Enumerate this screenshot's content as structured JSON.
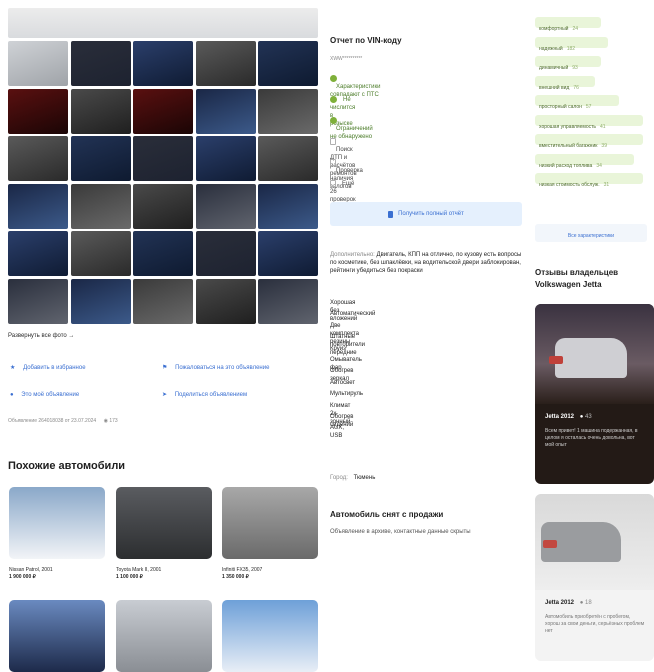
{
  "gallery": {
    "show_all_label": "Развернуть все фото →"
  },
  "actions": {
    "favorite": "Добавить в избранное",
    "complain": "Пожаловаться на это объявление",
    "my_ad": "Это моё объявление",
    "share": "Поделиться объявлением",
    "meta": "Объявление 264018038 от 23.07.2024",
    "views": "173"
  },
  "vin_report": {
    "title": "Отчет по VIN-коду",
    "vin": "XWW**********",
    "checks": [
      {
        "text": "Характеристики совпадают с ПТС",
        "ok": true
      },
      {
        "text": "Не числится в розыске",
        "ok": true
      },
      {
        "text": "Ограничений не обнаружено",
        "ok": true
      },
      {
        "text": "Поиск ДТП и расчётов ремонтов",
        "ok": false
      },
      {
        "text": "Проверка наличия залогов",
        "ok": false
      },
      {
        "text": "Ещё 26 проверок в полном отчёте",
        "ok": false
      }
    ],
    "button": "Получить полный отчёт"
  },
  "description": {
    "label": "Дополнительно:",
    "lead": "Двигатель, КПП на отлично, по кузову есть вопросы по косметике, без шпаклёвки, на водительской двери заблокирован, рейтинги убедиться без покраски",
    "items": [
      "Хорошая без вложений",
      "Автоматический",
      "Две комплекта резины",
      "Штатные повторители передние",
      "Круиз",
      "Омыватель фар",
      "Обогрев зеркал",
      "Автосвет",
      "Мультируль",
      "Климат 2х зонный",
      "Обогрев сидений",
      "AUX, USB"
    ],
    "city_label": "Город:",
    "city": "Тюмень"
  },
  "removed": {
    "title": "Автомобиль снят с продажи",
    "text": "Объявление в архиве, контактные данные скрыты"
  },
  "similar": {
    "title": "Похожие автомобили",
    "cars": [
      {
        "name": "Nissan Patrol, 2001",
        "price": "1 900 000 ₽"
      },
      {
        "name": "Toyota Mark II, 2001",
        "price": "1 100 000 ₽"
      },
      {
        "name": "Infiniti FX35, 2007",
        "price": "1 350 000 ₽"
      },
      {
        "name": "",
        "price": ""
      },
      {
        "name": "",
        "price": ""
      },
      {
        "name": "",
        "price": ""
      }
    ]
  },
  "tags": {
    "items": [
      {
        "label": "комфортный",
        "count": "24"
      },
      {
        "label": "надежный",
        "count": "182"
      },
      {
        "label": "динамичный",
        "count": "93"
      },
      {
        "label": "внешний вид",
        "count": "76"
      },
      {
        "label": "просторный салон",
        "count": "57"
      },
      {
        "label": "хорошая управляемость",
        "count": "41"
      },
      {
        "label": "вместительный багажник",
        "count": "39"
      },
      {
        "label": "низкий расход топлива",
        "count": "34"
      },
      {
        "label": "низкая стоимость обслуж.",
        "count": "31"
      }
    ],
    "more_button": "Все характеристики"
  },
  "reviews": {
    "title": "Отзывы владельцев Volkswagen Jetta",
    "cards": [
      {
        "title": "Jetta 2012",
        "count": "43",
        "text": "Всем привет! 1 машина подержанная, в целом я осталась очень довольна, вот мой опыт"
      },
      {
        "title": "Jetta 2012",
        "count": "18",
        "text": "Автомобиль приобретён с пробегом, хорош за свои деньги, серьёзных проблем нет"
      }
    ]
  }
}
